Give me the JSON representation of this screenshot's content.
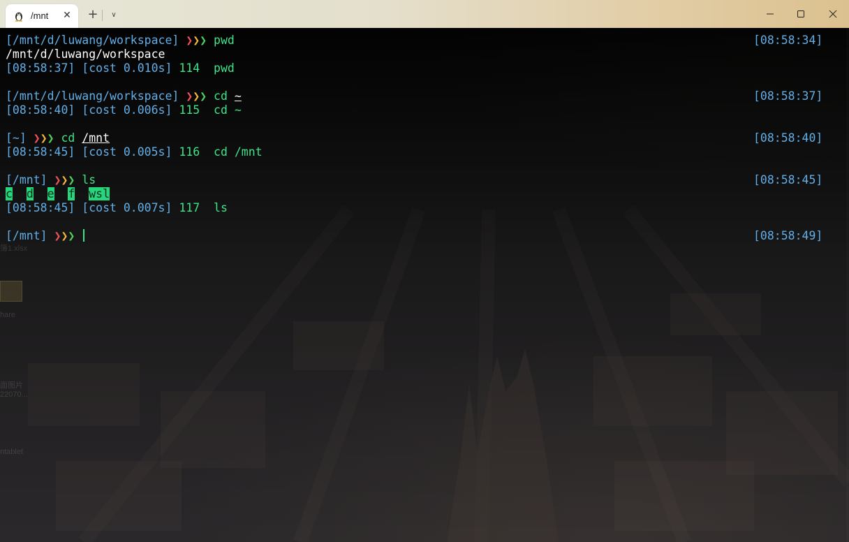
{
  "window": {
    "tab_title": "/mnt",
    "tab_icon": "linux-penguin-icon",
    "tab_close_glyph": "✕",
    "new_tab_glyph": "+",
    "dropdown_glyph": "∨"
  },
  "desktop_ghost_text": [
    "簿1.xlsx",
    "hare",
    "面图片",
    "22070...",
    "ntablet"
  ],
  "prompt_arrows": [
    "❯",
    "❯",
    "❯"
  ],
  "terminal": {
    "lines": [
      {
        "path": "[/mnt/d/luwang/workspace]",
        "command": "pwd",
        "argument": "",
        "timestamp": "[08:58:34]"
      },
      {
        "output": "/mnt/d/luwang/workspace"
      },
      {
        "meta": "[08:58:37] [cost 0.010s]",
        "history_num": "114",
        "history_cmd": "pwd"
      },
      {
        "path": "[/mnt/d/luwang/workspace]",
        "command": "cd",
        "argument": "~",
        "timestamp": "[08:58:37]"
      },
      {
        "meta": "[08:58:40] [cost 0.006s]",
        "history_num": "115",
        "history_cmd": "cd ~"
      },
      {
        "path": "[~]",
        "command": "cd",
        "argument": "/mnt",
        "timestamp": "[08:58:40]"
      },
      {
        "meta": "[08:58:45] [cost 0.005s]",
        "history_num": "116",
        "history_cmd": "cd /mnt"
      },
      {
        "path": "[/mnt]",
        "command": "ls",
        "argument": "",
        "timestamp": "[08:58:45]"
      },
      {
        "ls_entries": [
          "c",
          "d",
          "e",
          "f",
          "wsl"
        ]
      },
      {
        "meta": "[08:58:45] [cost 0.007s]",
        "history_num": "117",
        "history_cmd": "ls"
      },
      {
        "path": "[/mnt]",
        "command": "",
        "argument": "",
        "timestamp": "[08:58:49]"
      }
    ]
  },
  "colors": {
    "path_blue": "#61afe8",
    "command_green": "#3ee489",
    "arrow_red": "#f5515e",
    "arrow_yellow": "#f3b93a",
    "arrow_green": "#4ed45a",
    "ls_highlight": "#26d67c"
  }
}
